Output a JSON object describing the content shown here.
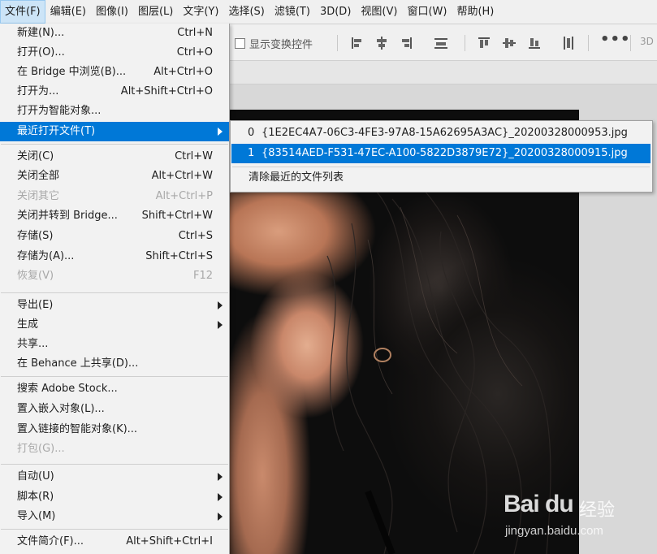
{
  "menubar": {
    "items": [
      {
        "label": "文件(F)",
        "active": true
      },
      {
        "label": "编辑(E)"
      },
      {
        "label": "图像(I)"
      },
      {
        "label": "图层(L)"
      },
      {
        "label": "文字(Y)"
      },
      {
        "label": "选择(S)"
      },
      {
        "label": "滤镜(T)"
      },
      {
        "label": "3D(D)"
      },
      {
        "label": "视图(V)"
      },
      {
        "label": "窗口(W)"
      },
      {
        "label": "帮助(H)"
      }
    ]
  },
  "options_bar": {
    "show_transform_controls": "显示变换控件",
    "more": "•••",
    "three_d": "3D"
  },
  "file_menu": {
    "items": [
      {
        "label": "新建(N)...",
        "shortcut": "Ctrl+N"
      },
      {
        "label": "打开(O)...",
        "shortcut": "Ctrl+O"
      },
      {
        "label": "在 Bridge 中浏览(B)...",
        "shortcut": "Alt+Ctrl+O"
      },
      {
        "label": "打开为...",
        "shortcut": "Alt+Shift+Ctrl+O"
      },
      {
        "label": "打开为智能对象..."
      },
      {
        "label": "最近打开文件(T)",
        "submenu": true,
        "highlighted": true
      },
      {
        "label": "关闭(C)",
        "shortcut": "Ctrl+W"
      },
      {
        "label": "关闭全部",
        "shortcut": "Alt+Ctrl+W"
      },
      {
        "label": "关闭其它",
        "shortcut": "Alt+Ctrl+P",
        "disabled": true
      },
      {
        "label": "关闭并转到 Bridge...",
        "shortcut": "Shift+Ctrl+W"
      },
      {
        "label": "存储(S)",
        "shortcut": "Ctrl+S"
      },
      {
        "label": "存储为(A)...",
        "shortcut": "Shift+Ctrl+S"
      },
      {
        "label": "恢复(V)",
        "shortcut": "F12",
        "disabled": true
      },
      {
        "label": "导出(E)",
        "submenu": true
      },
      {
        "label": "生成",
        "submenu": true
      },
      {
        "label": "共享..."
      },
      {
        "label": "在 Behance 上共享(D)..."
      },
      {
        "label": "搜索 Adobe Stock..."
      },
      {
        "label": "置入嵌入对象(L)..."
      },
      {
        "label": "置入链接的智能对象(K)..."
      },
      {
        "label": "打包(G)...",
        "disabled": true
      },
      {
        "label": "自动(U)",
        "submenu": true
      },
      {
        "label": "脚本(R)",
        "submenu": true
      },
      {
        "label": "导入(M)",
        "submenu": true
      },
      {
        "label": "文件简介(F)...",
        "shortcut": "Alt+Shift+Ctrl+I"
      }
    ]
  },
  "recent_submenu": {
    "files": [
      {
        "index": "0",
        "name": "{1E2EC4A7-06C3-4FE3-97A8-15A62695A3AC}_20200328000953.jpg"
      },
      {
        "index": "1",
        "name": "{83514AED-F531-47EC-A100-5822D3879E72}_20200328000915.jpg",
        "highlighted": true
      }
    ],
    "clear_label": "清除最近的文件列表"
  },
  "watermark": {
    "logo": "Bai du",
    "text": "经验",
    "url": "jingyan.baidu.com"
  },
  "colors": {
    "menu_highlight": "#0078d7",
    "menubar_active": "#cce4f7"
  }
}
